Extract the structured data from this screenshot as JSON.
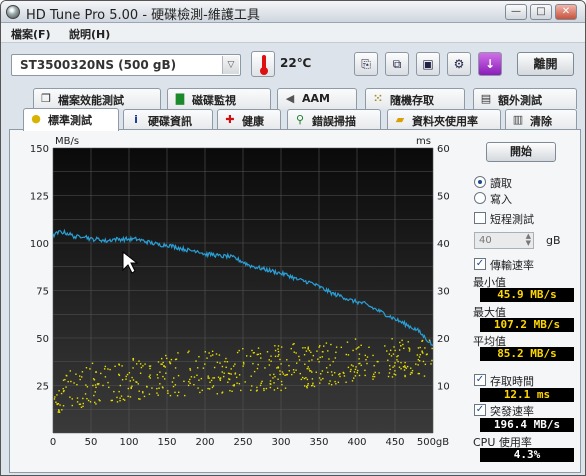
{
  "window": {
    "title": "HD Tune Pro  5.00 - 硬碟檢測-維護工具",
    "controls": [
      "minimize",
      "maximize",
      "close"
    ]
  },
  "menu": {
    "items": [
      {
        "label": "檔案(F)"
      },
      {
        "label": "說明(H)"
      }
    ]
  },
  "toolbar": {
    "drive": "ST3500320NS (500 gB)",
    "temperature": "22℃",
    "icons": [
      "copy-icon",
      "paste-icon",
      "save-icon",
      "options-icon",
      "download-icon"
    ],
    "exit_label": "離開"
  },
  "tabs": {
    "row1": [
      {
        "label": "檔案效能測試",
        "icon": "file-benchmark-icon"
      },
      {
        "label": "磁碟監視",
        "icon": "disk-monitor-icon"
      },
      {
        "label": "AAM",
        "icon": "speaker-icon"
      },
      {
        "label": "隨機存取",
        "icon": "random-access-icon"
      },
      {
        "label": "額外測試",
        "icon": "extra-tests-icon"
      }
    ],
    "row2": [
      {
        "label": "標準測試",
        "icon": "benchmark-icon",
        "active": true
      },
      {
        "label": "硬碟資訊",
        "icon": "info-icon"
      },
      {
        "label": "健康",
        "icon": "health-icon"
      },
      {
        "label": "錯誤掃描",
        "icon": "error-scan-icon"
      },
      {
        "label": "資料夾使用率",
        "icon": "folder-usage-icon"
      },
      {
        "label": "清除",
        "icon": "erase-icon"
      }
    ]
  },
  "side": {
    "start_label": "開始",
    "read_label": "讀取",
    "write_label": "寫入",
    "short_test_label": "短程測試",
    "short_test_value": "40",
    "short_test_unit": "gB",
    "transfer_rate_label": "傳輸速率",
    "min_label": "最小值",
    "min_value": "45.9 MB/s",
    "max_label": "最大值",
    "max_value": "107.2 MB/s",
    "avg_label": "平均值",
    "avg_value": "85.2 MB/s",
    "access_time_label": "存取時間",
    "access_time_value": "12.1 ms",
    "burst_rate_label": "突發速率",
    "burst_rate_value": "196.4 MB/s",
    "cpu_label": "CPU 使用率",
    "cpu_value": "4.3%"
  },
  "chart_data": {
    "type": "line",
    "y_left_unit": "MB/s",
    "y_right_unit": "ms",
    "ylim_left": [
      0,
      150
    ],
    "ylim_right": [
      0,
      60
    ],
    "xlim": [
      0,
      500
    ],
    "x_ticks": [
      "0",
      "50",
      "100",
      "150",
      "200",
      "250",
      "300",
      "350",
      "400",
      "450",
      "500gB"
    ],
    "y_left_ticks": [
      "150",
      "125",
      "100",
      "75",
      "50",
      "25"
    ],
    "y_right_ticks": [
      "60",
      "50",
      "40",
      "30",
      "20",
      "10"
    ],
    "grid": true,
    "series": [
      {
        "kind": "transfer-rate",
        "axis": "left",
        "color": "#2a9fd6",
        "x": [
          0,
          10,
          20,
          30,
          40,
          50,
          60,
          70,
          80,
          90,
          100,
          110,
          120,
          130,
          140,
          150,
          160,
          170,
          180,
          190,
          200,
          210,
          220,
          230,
          240,
          250,
          260,
          270,
          280,
          290,
          300,
          310,
          320,
          330,
          340,
          350,
          360,
          370,
          380,
          390,
          400,
          410,
          420,
          430,
          440,
          450,
          460,
          470,
          480,
          490,
          500
        ],
        "values": [
          104,
          106,
          105,
          103,
          104,
          102,
          102,
          101,
          102,
          102,
          102,
          102,
          101,
          100,
          99,
          99,
          98,
          97,
          96,
          96,
          94,
          94,
          93,
          93,
          92,
          90,
          88,
          87,
          86,
          85,
          84,
          83,
          81,
          80,
          79,
          77,
          75,
          73,
          72,
          70,
          69,
          68,
          66,
          64,
          62,
          60,
          58,
          56,
          54,
          50,
          46
        ]
      },
      {
        "kind": "access-time",
        "axis": "right",
        "color": "#e8e000",
        "style": "scatter",
        "x": [
          0,
          50,
          100,
          150,
          200,
          250,
          300,
          350,
          400,
          450,
          500
        ],
        "band_min": [
          4,
          6,
          7,
          8,
          8,
          9,
          9,
          10,
          11,
          12,
          12
        ],
        "band_max": [
          12,
          15,
          16,
          17,
          18,
          18,
          19,
          19,
          20,
          20,
          20
        ]
      }
    ]
  }
}
